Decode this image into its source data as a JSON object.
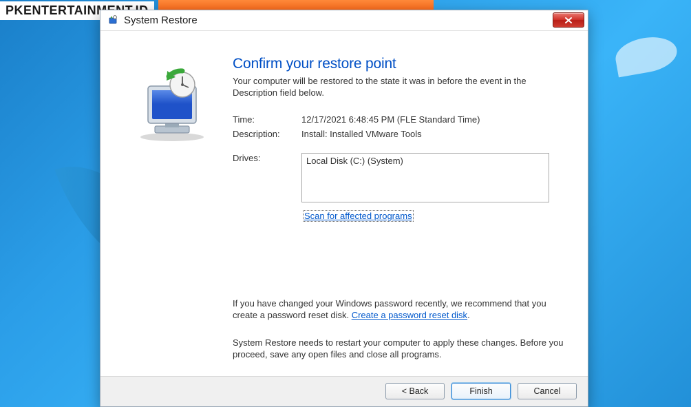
{
  "watermark": "PKENTERTAINMENT.ID",
  "window": {
    "title": "System Restore",
    "heading": "Confirm your restore point",
    "subheading": "Your computer will be restored to the state it was in before the event in the Description field below.",
    "time_label": "Time:",
    "time_value": "12/17/2021 6:48:45 PM (FLE Standard Time)",
    "desc_label": "Description:",
    "desc_value": "Install: Installed VMware Tools",
    "drives_label": "Drives:",
    "drives_value": "Local Disk (C:) (System)",
    "scan_link": "Scan for affected programs",
    "info1_a": "If you have changed your Windows password recently, we recommend that you create a password reset disk. ",
    "info1_link": "Create a password reset disk",
    "info1_b": ".",
    "info2": "System Restore needs to restart your computer to apply these changes. Before you proceed, save any open files and close all programs.",
    "back_label": "< Back",
    "finish_label": "Finish",
    "cancel_label": "Cancel"
  }
}
